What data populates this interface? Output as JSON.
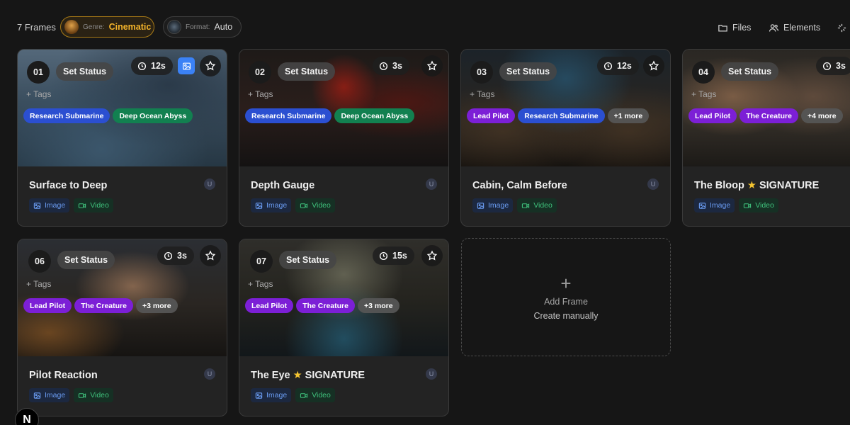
{
  "toolbar": {
    "frame_count": "7 Frames",
    "genre_label": "Genre:",
    "genre_value": "Cinematic",
    "format_label": "Format:",
    "format_value": "Auto",
    "files_label": "Files",
    "elements_label": "Elements"
  },
  "colors": {
    "accent_genre": "#f3b32a",
    "tag_blue": "#2b4fd1",
    "tag_green": "#128050",
    "tag_purple": "#7c1fd6",
    "image_chip": "#6a9cf2",
    "video_chip": "#3fc07b"
  },
  "common": {
    "set_status": "Set Status",
    "add_tags": "+ Tags",
    "image": "Image",
    "video": "Video",
    "user_initial": "U"
  },
  "cards": [
    {
      "number": "01",
      "duration": "12s",
      "title": "Surface to Deep",
      "tags": [
        "Research Submarine",
        "Deep Ocean Abyss"
      ]
    },
    {
      "number": "02",
      "duration": "3s",
      "title": "Depth Gauge",
      "tags": [
        "Research Submarine",
        "Deep Ocean Abyss"
      ]
    },
    {
      "number": "03",
      "duration": "12s",
      "title": "Cabin, Calm Before",
      "tags": [
        "Lead Pilot",
        "Research Submarine",
        "+1 more"
      ]
    },
    {
      "number": "04",
      "duration": "3s",
      "title": "The Bloop",
      "badge": "SIGNATURE",
      "tags": [
        "Lead Pilot",
        "The Creature",
        "+4 more"
      ]
    },
    {
      "number": "06",
      "duration": "3s",
      "title": "Pilot Reaction",
      "tags": [
        "Lead Pilot",
        "The Creature",
        "+3 more"
      ]
    },
    {
      "number": "07",
      "duration": "15s",
      "title": "The Eye",
      "badge": "SIGNATURE",
      "tags": [
        "Lead Pilot",
        "The Creature",
        "+3 more"
      ]
    }
  ],
  "add_frame": {
    "plus": "+",
    "title": "Add Frame",
    "subtitle": "Create manually"
  },
  "corner_badge": "N"
}
